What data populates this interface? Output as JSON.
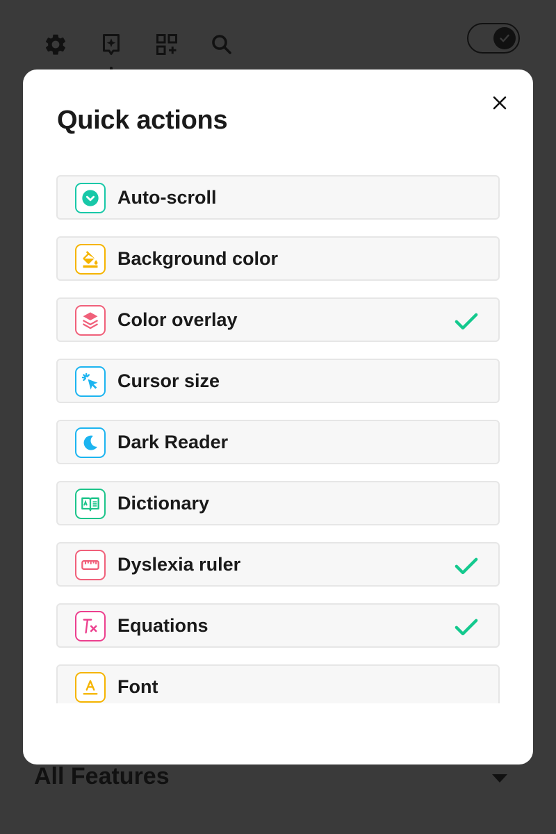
{
  "toolbar": {
    "icons": [
      "gear-icon",
      "sparkle-bookmark-icon",
      "grid-add-icon",
      "search-icon"
    ],
    "toggle_on": true
  },
  "section": {
    "title": "All Features"
  },
  "modal": {
    "title": "Quick actions",
    "close_icon": "close-icon",
    "items": [
      {
        "label": "Auto-scroll",
        "icon": "chevron-down-circle-icon",
        "color": "#18c8a8",
        "checked": false
      },
      {
        "label": "Background color",
        "icon": "paint-bucket-icon",
        "color": "#f5b400",
        "checked": false
      },
      {
        "label": "Color overlay",
        "icon": "layers-icon",
        "color": "#f0607a",
        "checked": true
      },
      {
        "label": "Cursor size",
        "icon": "cursor-click-icon",
        "color": "#1cb4f0",
        "checked": false
      },
      {
        "label": "Dark Reader",
        "icon": "moon-icon",
        "color": "#1cb4f0",
        "checked": false
      },
      {
        "label": "Dictionary",
        "icon": "book-icon",
        "color": "#1cc48a",
        "checked": false
      },
      {
        "label": "Dyslexia ruler",
        "icon": "ruler-icon",
        "color": "#f0607a",
        "checked": true
      },
      {
        "label": "Equations",
        "icon": "function-icon",
        "color": "#ec3f8e",
        "checked": true
      },
      {
        "label": "Font",
        "icon": "font-icon",
        "color": "#f5b400",
        "checked": false
      }
    ],
    "check_color": "#14c98e"
  }
}
